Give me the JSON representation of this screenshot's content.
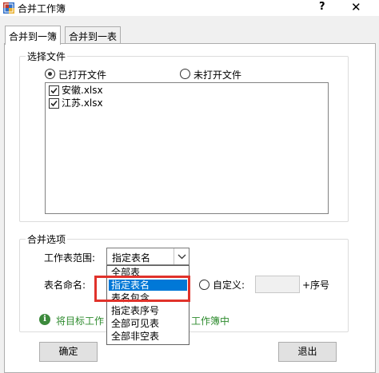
{
  "window": {
    "title": "合并工作簿",
    "help_glyph": "?",
    "close_glyph": "✕"
  },
  "tabs": [
    {
      "label": "合并到一簿",
      "active": true
    },
    {
      "label": "合并到一表",
      "active": false
    }
  ],
  "select_files": {
    "group_title": "选择文件",
    "radio_opened": {
      "label": "已打开文件",
      "checked": true
    },
    "radio_unopened": {
      "label": "未打开文件",
      "checked": false
    },
    "files": [
      {
        "name": "安徽.xlsx",
        "checked": true
      },
      {
        "name": "江苏.xlsx",
        "checked": true
      }
    ]
  },
  "merge_options": {
    "group_title": "合并选项",
    "scope_label": "工作表范围:",
    "scope_selected": "指定表名",
    "naming_label": "表名命名:",
    "custom_radio_label": "自定义:",
    "custom_value": "",
    "suffix_label": "+序号",
    "dropdown_options": [
      {
        "label": "全部表",
        "selected": false
      },
      {
        "label": "指定表名",
        "selected": true
      },
      {
        "label": "表名包含",
        "selected": false
      },
      {
        "label": "指定表序号",
        "selected": false
      },
      {
        "label": "全部可见表",
        "selected": false
      },
      {
        "label": "全部非空表",
        "selected": false
      }
    ]
  },
  "info": {
    "text_left": "将目标工作",
    "text_right": "工作簿中"
  },
  "buttons": {
    "ok": "确定",
    "exit": "退出"
  },
  "colors": {
    "highlight_box": "#e0322b",
    "selection": "#0078d7",
    "info_text": "#2e8b2e"
  }
}
